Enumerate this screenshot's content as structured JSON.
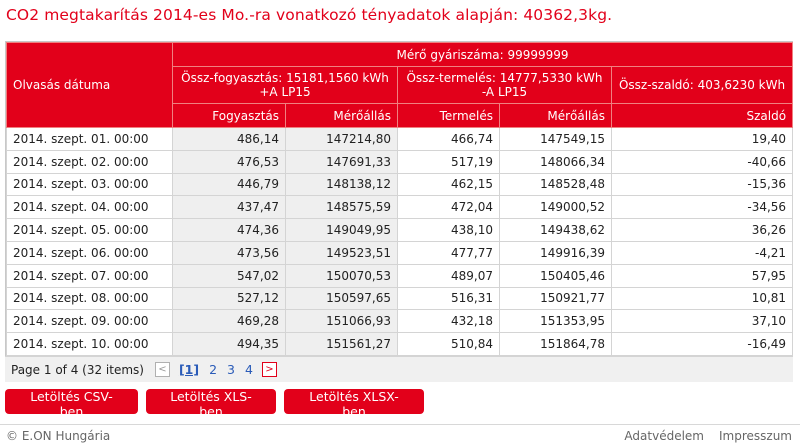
{
  "title": "CO2 megtakarítás 2014-es Mo.-ra vonatkozó tényadatok alapján: 40362,3kg.",
  "table": {
    "meter_header": "Mérő gyáriszáma: 99999999",
    "date_header": "Olvasás dátuma",
    "group_consumption": "Össz-fogyasztás: 15181,1560 kWh +A LP15",
    "group_production": "Össz-termelés: 14777,5330 kWh -A LP15",
    "group_balance": "Össz-szaldó: 403,6230 kWh",
    "columns": [
      "Fogyasztás",
      "Mérőállás",
      "Termelés",
      "Mérőállás",
      "Szaldó"
    ],
    "rows": [
      [
        "2014. szept. 01. 00:00",
        "486,14",
        "147214,80",
        "466,74",
        "147549,15",
        "19,40"
      ],
      [
        "2014. szept. 02. 00:00",
        "476,53",
        "147691,33",
        "517,19",
        "148066,34",
        "-40,66"
      ],
      [
        "2014. szept. 03. 00:00",
        "446,79",
        "148138,12",
        "462,15",
        "148528,48",
        "-15,36"
      ],
      [
        "2014. szept. 04. 00:00",
        "437,47",
        "148575,59",
        "472,04",
        "149000,52",
        "-34,56"
      ],
      [
        "2014. szept. 05. 00:00",
        "474,36",
        "149049,95",
        "438,10",
        "149438,62",
        "36,26"
      ],
      [
        "2014. szept. 06. 00:00",
        "473,56",
        "149523,51",
        "477,77",
        "149916,39",
        "-4,21"
      ],
      [
        "2014. szept. 07. 00:00",
        "547,02",
        "150070,53",
        "489,07",
        "150405,46",
        "57,95"
      ],
      [
        "2014. szept. 08. 00:00",
        "527,12",
        "150597,65",
        "516,31",
        "150921,77",
        "10,81"
      ],
      [
        "2014. szept. 09. 00:00",
        "469,28",
        "151066,93",
        "432,18",
        "151353,95",
        "37,10"
      ],
      [
        "2014. szept. 10. 00:00",
        "494,35",
        "151561,27",
        "510,84",
        "151864,78",
        "-16,49"
      ]
    ]
  },
  "pager": {
    "info": "Page 1 of 4 (32 items)",
    "prev_glyph": "<",
    "next_glyph": ">",
    "pages": [
      "[1]",
      "2",
      "3",
      "4"
    ]
  },
  "buttons": {
    "csv": "Letöltés CSV-ben",
    "xls": "Letöltés XLS-ben",
    "xlsx": "Letöltés XLSX-ben"
  },
  "footer": {
    "copyright": "© E.ON Hungária",
    "privacy": "Adatvédelem",
    "imprint": "Impresszum"
  },
  "colors": {
    "accent": "#e2001a",
    "link": "#2a5bb8"
  }
}
